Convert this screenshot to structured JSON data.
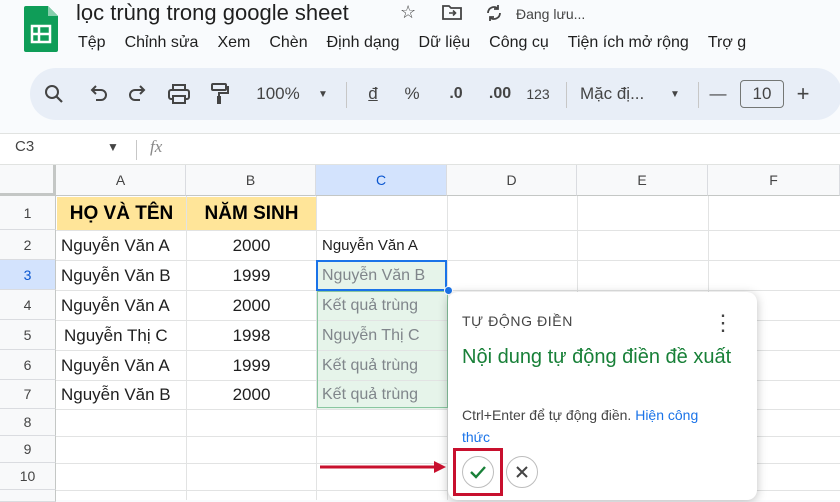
{
  "window": {
    "title": "lọc trùng trong google sheet",
    "save_status": "Đang lưu..."
  },
  "menu": [
    "Tệp",
    "Chỉnh sửa",
    "Xem",
    "Chèn",
    "Định dạng",
    "Dữ liệu",
    "Công cụ",
    "Tiện ích mở rộng",
    "Trợ g"
  ],
  "toolbar": {
    "zoom": "100%",
    "currency": "đ",
    "percent": "%",
    "dec_decrease": ".0",
    "dec_increase": ".00",
    "number_format": "123",
    "font": "Mặc đị...",
    "font_size": "10",
    "minus": "—",
    "plus": "+"
  },
  "formula_bar": {
    "cell_ref": "C3",
    "fx": "fx"
  },
  "columns": [
    "A",
    "B",
    "C",
    "D",
    "E",
    "F"
  ],
  "rows": [
    "1",
    "2",
    "3",
    "4",
    "5",
    "6",
    "7",
    "8",
    "9",
    "10"
  ],
  "sheet": {
    "header": [
      "HỌ VÀ TÊN",
      "NĂM SINH"
    ],
    "data": [
      [
        "Nguyễn Văn A",
        "2000"
      ],
      [
        "Nguyễn Văn B",
        "1999"
      ],
      [
        "Nguyễn Văn A",
        "2000"
      ],
      [
        "Nguyễn Thị C",
        "1998"
      ],
      [
        "Nguyễn Văn A",
        "1999"
      ],
      [
        "Nguyễn Văn B",
        "2000"
      ]
    ],
    "c2": "Nguyễn Văn A",
    "suggestions": [
      "Nguyễn Văn B",
      "Kết quả trùng",
      "Nguyễn Thị C",
      "Kết quả trùng",
      "Kết quả trùng"
    ]
  },
  "autofill_popup": {
    "title": "TỰ ĐỘNG ĐIỀN",
    "heading": "Nội dung tự động điền đề xuất",
    "hint": "Ctrl+Enter để tự động điền.",
    "link": "Hiện công thức"
  },
  "colors": {
    "header_fill": "#ffe599",
    "suggest_green": "#188038",
    "selection_blue": "#1a73e8",
    "callout_red": "#c8102e"
  }
}
